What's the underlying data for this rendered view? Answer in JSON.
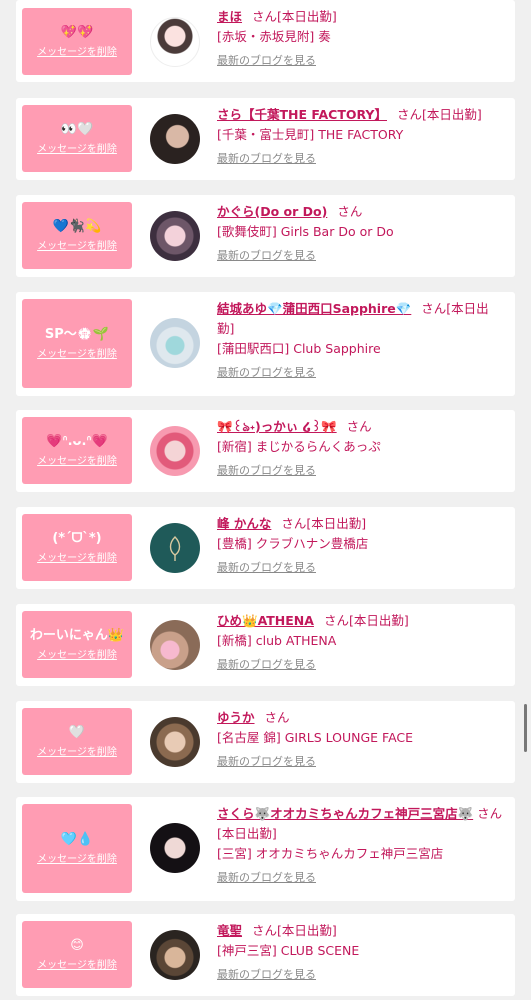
{
  "common": {
    "delete_label": "メッセージを削除",
    "blog_label": "最新のブログを見る"
  },
  "cards": [
    {
      "message": "💖💖",
      "name": "まほ",
      "suffix": "さん[本日出勤]",
      "shop": "[赤坂・赤坂見附] 奏"
    },
    {
      "message": "👀🤍",
      "name": "さら【千葉THE FACTORY】",
      "suffix": "さん[本日出勤]",
      "shop": "[千葉・富士見町] THE FACTORY"
    },
    {
      "message": "💙🐈‍⬛💫",
      "name": "かぐら(Do or Do)",
      "suffix": "さん",
      "shop": "[歌舞伎町] Girls Bar Do or Do"
    },
    {
      "message": "SP〜💮🌱",
      "name": "結城あゆ💎蒲田西口Sapphire💎",
      "suffix": "さん[本日出勤]",
      "shop": "[蒲田駅西口] Club Sapphire"
    },
    {
      "message": "💗ᐢ.ᴗ.ᐢ💗",
      "name": "🎀꒰ঌ˖)っかぃ ໒꒱🎀",
      "suffix": "さん",
      "shop": "[新宿] まじかるらんくあっぷ"
    },
    {
      "message": "(*ˊᗜˋ*)",
      "name": "峰 かんな",
      "suffix": "さん[本日出勤]",
      "shop": "[豊橋] クラブハナン豊橋店"
    },
    {
      "message": "わーいにゃん👑",
      "name": "ひめ👑ATHENA",
      "suffix": "さん[本日出勤]",
      "shop": "[新橋] club ATHENA"
    },
    {
      "message": "🤍",
      "name": "ゆうか",
      "suffix": "さん",
      "shop": "[名古屋 錦] GIRLS LOUNGE FACE"
    },
    {
      "message": "🩵💧",
      "name": "さくら🐺オオカミちゃんカフェ神戸三宮店🐺",
      "suffix": "さん[本日出勤]",
      "shop": "[三宮] オオカミちゃんカフェ神戸三宮店"
    },
    {
      "message": "😊",
      "name": "竜聖",
      "suffix": "さん[本日出勤]",
      "shop": "[神戸三宮] CLUB SCENE"
    }
  ]
}
